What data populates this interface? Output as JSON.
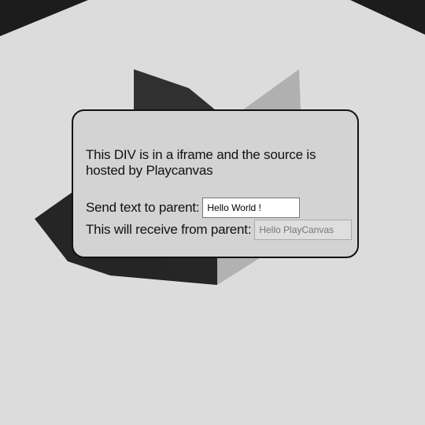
{
  "scene": {
    "background_color": "#dcdcdc",
    "shape_dark_color": "#222222",
    "shape_light_color": "#b4b4b4",
    "shadow_color": "#2a2a2a"
  },
  "panel": {
    "description": "This DIV is in a iframe and the source is hosted by Playcanvas",
    "send_label": "Send text to parent:",
    "send_value": "Hello World !",
    "receive_label": "This will receive from parent:",
    "receive_value": "Hello PlayCanvas"
  }
}
